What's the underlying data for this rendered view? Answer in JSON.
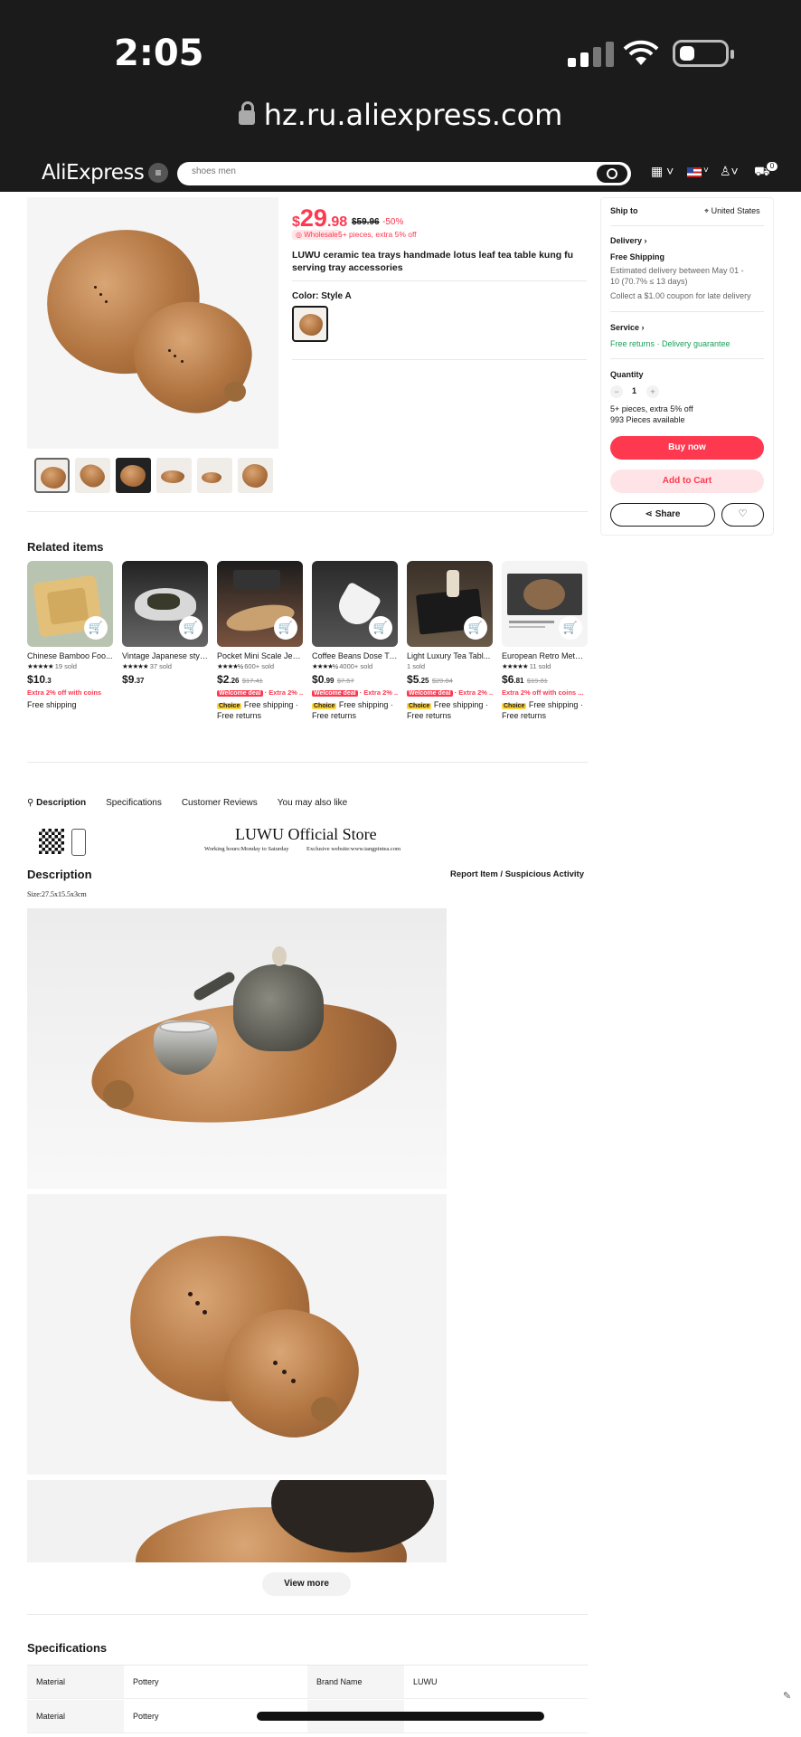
{
  "status": {
    "time": "2:05"
  },
  "browser": {
    "url": "hz.ru.aliexpress.com"
  },
  "header": {
    "logo": "AliExpress",
    "search_placeholder": "shoes men",
    "cart_count": "0"
  },
  "product": {
    "currency": "$",
    "price_int": "29",
    "price_dec": ".98",
    "old_price": "$59.96",
    "discount": "-50%",
    "wholesale_badge": "Wholesale",
    "wholesale_note": "5+ pieces, extra 5% off",
    "title": "LUWU ceramic tea trays handmade lotus leaf tea table kung fu serving tray accessories",
    "color_label": "Color: Style A"
  },
  "sidebar": {
    "ship_to_label": "Ship to",
    "ship_to_value": "United States",
    "delivery_label": "Delivery",
    "free_shipping": "Free Shipping",
    "estimate_line1": "Estimated delivery between May 01 -",
    "estimate_line2": "10 (70.7% ≤ 13 days)",
    "coupon": "Collect a $1.00 coupon for late delivery",
    "service_label": "Service",
    "service_value": "Free returns · Delivery guarantee",
    "quantity_label": "Quantity",
    "quantity_value": "1",
    "qty_note": "5+ pieces, extra 5% off",
    "available": "993 Pieces available",
    "buy_now": "Buy now",
    "add_to_cart": "Add to Cart",
    "share": "Share"
  },
  "related": {
    "title": "Related items",
    "items": [
      {
        "name": "Chinese Bamboo Foo...",
        "sold": "19 sold",
        "price_int": "10",
        "price_dec": ".3",
        "old": "",
        "extra": "Extra 2% off with coins",
        "ship": "Free shipping",
        "ship2": ""
      },
      {
        "name": "Vintage Japanese styl...",
        "sold": "37 sold",
        "price_int": "9",
        "price_dec": ".37",
        "old": "",
        "extra": "",
        "ship": "",
        "ship2": ""
      },
      {
        "name": "Pocket Mini Scale Jew...",
        "sold": "600+ sold",
        "price_int": "2",
        "price_dec": ".26",
        "old": "$17.41",
        "extra": "· Extra 2% ...",
        "welcome": "Welcome deal",
        "ship": "Free shipping ·",
        "ship2": "Free returns",
        "choice": "Choice"
      },
      {
        "name": "Coffee Beans Dose Tr...",
        "sold": "4000+ sold",
        "price_int": "0",
        "price_dec": ".99",
        "old": "$7.57",
        "extra": "· Extra 2% ...",
        "welcome": "Welcome deal",
        "ship": "Free shipping ·",
        "ship2": "Free returns",
        "choice": "Choice"
      },
      {
        "name": "Light Luxury Tea Tabl...",
        "sold": "1 sold",
        "price_int": "5",
        "price_dec": ".25",
        "old": "$29.84",
        "extra": "· Extra 2% ...",
        "welcome": "Welcome deal",
        "ship": "Free shipping ·",
        "ship2": "Free returns",
        "choice": "Choice"
      },
      {
        "name": "European Retro Metal...",
        "sold": "11 sold",
        "price_int": "6",
        "price_dec": ".81",
        "old": "$19.81",
        "extra": "Extra 2% off with coins ...",
        "ship": "Free shipping ·",
        "ship2": "Free returns",
        "choice": "Choice"
      }
    ]
  },
  "tabs": [
    "Description",
    "Specifications",
    "Customer Reviews",
    "You may also like"
  ],
  "description": {
    "store_name": "LUWU Official Store",
    "store_hours": "Working hours:Monday to Saturday",
    "store_web": "Exclusive website:www.tangpintea.com",
    "title": "Description",
    "report": "Report Item / Suspicious Activity",
    "size": "Size:27.5x15.5x3cm",
    "view_more": "View more"
  },
  "specs": {
    "title": "Specifications",
    "rows": [
      {
        "k1": "Material",
        "v1": "Pottery",
        "k2": "Brand Name",
        "v2": "LUWU"
      },
      {
        "k1": "Material",
        "v1": "Pottery",
        "k2": "",
        "v2": ""
      }
    ]
  },
  "colors": {
    "accent": "#fd384f",
    "green": "#18a058",
    "dark": "#1b1b1b"
  }
}
